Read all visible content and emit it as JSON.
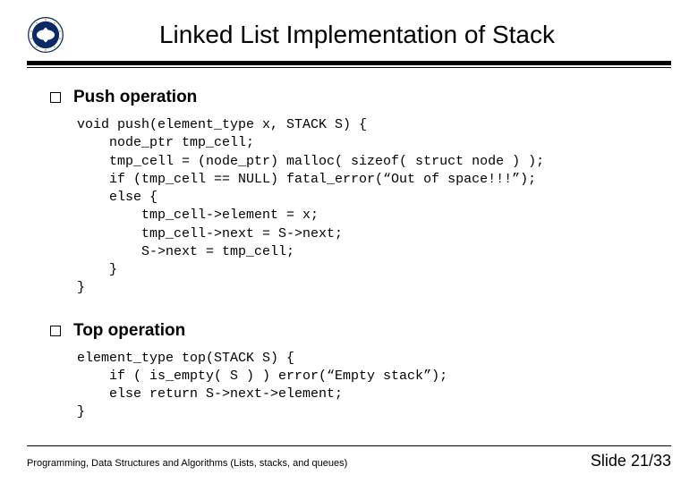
{
  "header": {
    "title": "Linked List Implementation of Stack"
  },
  "sections": {
    "push": {
      "title": "Push operation",
      "code": "void push(element_type x, STACK S) {\n    node_ptr tmp_cell;\n    tmp_cell = (node_ptr) malloc( sizeof( struct node ) );\n    if (tmp_cell == NULL) fatal_error(“Out of space!!!”);\n    else {\n        tmp_cell->element = x;\n        tmp_cell->next = S->next;\n        S->next = tmp_cell;\n    }\n}"
    },
    "top": {
      "title": "Top operation",
      "code": "element_type top(STACK S) {\n    if ( is_empty( S ) ) error(“Empty stack”);\n    else return S->next->element;\n}"
    }
  },
  "footer": {
    "left": "Programming, Data Structures and Algorithms  (Lists, stacks, and queues)",
    "right": "Slide 21/33"
  }
}
